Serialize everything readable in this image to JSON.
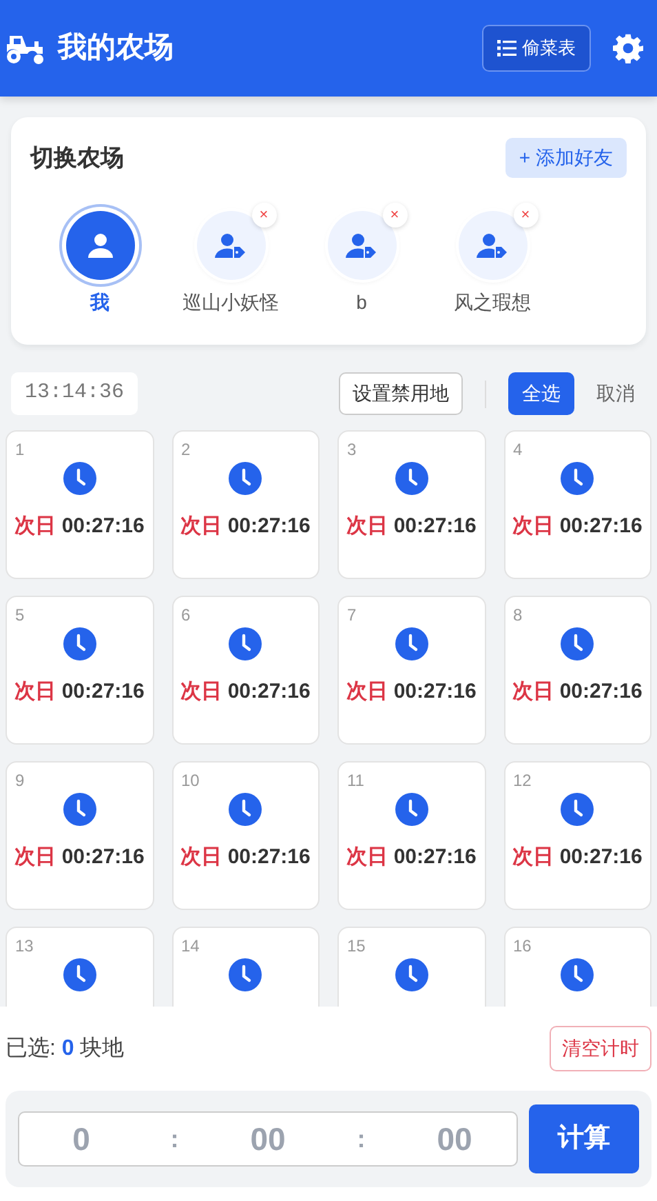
{
  "header": {
    "title": "我的农场",
    "steal_list_button": "偷菜表"
  },
  "farm_switch": {
    "title": "切换农场",
    "add_friend_button": "+ 添加好友",
    "farms": [
      {
        "name": "我",
        "kind": "self",
        "selected": true
      },
      {
        "name": "巡山小妖怪",
        "kind": "friend",
        "selected": false,
        "remove_mark": "×"
      },
      {
        "name": "b",
        "kind": "friend",
        "selected": false,
        "remove_mark": "×"
      },
      {
        "name": "风之瑕想",
        "kind": "friend",
        "selected": false,
        "remove_mark": "×"
      }
    ]
  },
  "toolbar": {
    "clock": "13:14:36",
    "set_forbidden_button": "设置禁用地",
    "select_all_button": "全选",
    "cancel_button": "取消"
  },
  "plots": [
    {
      "number": "1",
      "tag": "次日",
      "time": "00:27:16",
      "selected": false
    },
    {
      "number": "2",
      "tag": "次日",
      "time": "00:27:16",
      "selected": false
    },
    {
      "number": "3",
      "tag": "次日",
      "time": "00:27:16",
      "selected": false
    },
    {
      "number": "4",
      "tag": "次日",
      "time": "00:27:16",
      "selected": false
    },
    {
      "number": "5",
      "tag": "次日",
      "time": "00:27:16",
      "selected": false
    },
    {
      "number": "6",
      "tag": "次日",
      "time": "00:27:16",
      "selected": false
    },
    {
      "number": "7",
      "tag": "次日",
      "time": "00:27:16",
      "selected": false
    },
    {
      "number": "8",
      "tag": "次日",
      "time": "00:27:16",
      "selected": false
    },
    {
      "number": "9",
      "tag": "次日",
      "time": "00:27:16",
      "selected": false
    },
    {
      "number": "10",
      "tag": "次日",
      "time": "00:27:16",
      "selected": false
    },
    {
      "number": "11",
      "tag": "次日",
      "time": "00:27:16",
      "selected": false
    },
    {
      "number": "12",
      "tag": "次日",
      "time": "00:27:16",
      "selected": false
    },
    {
      "number": "13",
      "selected": false
    },
    {
      "number": "14",
      "selected": false
    },
    {
      "number": "15",
      "selected": false
    },
    {
      "number": "16",
      "selected": false
    }
  ],
  "bottom": {
    "selected_label": "已选:",
    "selected_count": "0",
    "selected_unit": "块地",
    "clear_timers_button": "清空计时",
    "time_fields": [
      {
        "placeholder": "0"
      },
      {
        "placeholder": "00"
      },
      {
        "placeholder": "00"
      }
    ],
    "separators": [
      ":",
      ":"
    ],
    "calculate_button": "计算"
  }
}
